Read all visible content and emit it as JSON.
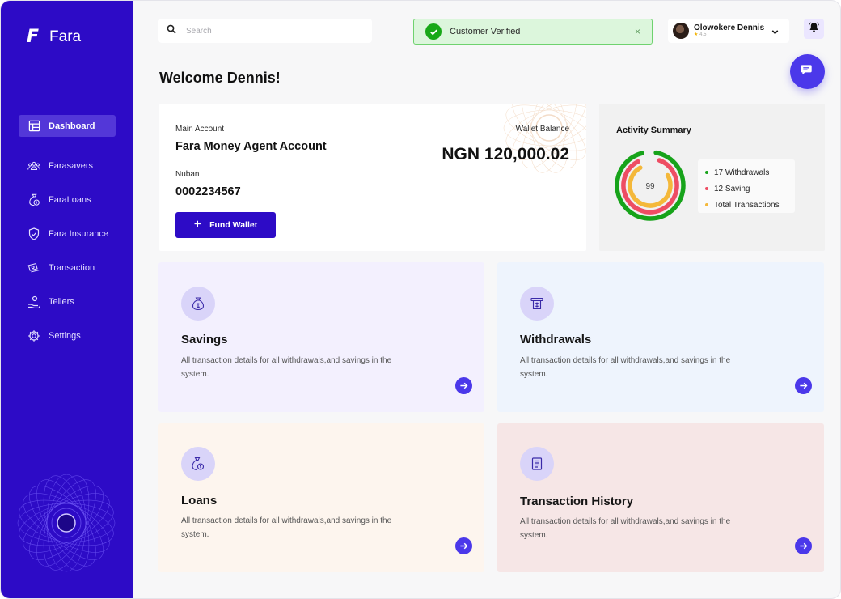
{
  "app": {
    "name": "Fara"
  },
  "colors": {
    "brand": "#2d0bc6",
    "accent": "#4b38ea",
    "success": "#18a818",
    "withdrawals": "#17a31a",
    "saving": "#ee4d63",
    "transactions": "#f4b83a"
  },
  "sidebar": {
    "items": [
      {
        "label": "Dashboard",
        "icon": "dashboard-icon",
        "active": true
      },
      {
        "label": "Farasavers",
        "icon": "users-group-icon",
        "active": false
      },
      {
        "label": "FaraLoans",
        "icon": "money-bag-icon",
        "active": false
      },
      {
        "label": "Fara Insurance",
        "icon": "shield-icon",
        "active": false
      },
      {
        "label": "Transaction",
        "icon": "cash-icon",
        "active": false
      },
      {
        "label": "Tellers",
        "icon": "teller-icon",
        "active": false
      },
      {
        "label": "Settings",
        "icon": "gear-icon",
        "active": false
      }
    ]
  },
  "header": {
    "search_placeholder": "Search",
    "toast": "Customer Verified",
    "toast_close": "×",
    "user": {
      "name": "Olowokere Dennis",
      "stars": "★",
      "rating": "4.5"
    }
  },
  "main": {
    "welcome": "Welcome Dennis!",
    "account": {
      "main_account_label": "Main Account",
      "main_account_name": "Fara Money Agent Account",
      "nuban_label": "Nuban",
      "nuban": "0002234567",
      "wallet_label": "Wallet Balance",
      "wallet_balance": "NGN 120,000.02",
      "fund_button": "Fund Wallet",
      "fund_button_icon": "plus-icon"
    },
    "activity": {
      "title": "Activity Summary",
      "center_value": "99",
      "legend": [
        {
          "label": "17 Withdrawals",
          "color": "#17a31a"
        },
        {
          "label": "12 Saving",
          "color": "#ee4d63"
        },
        {
          "label": "Total Transactions",
          "color": "#f4b83a"
        }
      ]
    },
    "tiles": [
      {
        "title": "Savings",
        "desc": "All transaction details for all withdrawals,and savings in the system.",
        "icon": "money-bag-icon",
        "bg": "#f3f0fe"
      },
      {
        "title": "Withdrawals",
        "desc": "All transaction details for all withdrawals,and savings  in the system.",
        "icon": "atm-withdrawal-icon",
        "bg": "#eef4fd"
      },
      {
        "title": "Loans",
        "desc": "All transaction details for all withdrawals,and savings in the system.",
        "icon": "loan-bag-icon",
        "bg": "#fdf5ee"
      },
      {
        "title": "Transaction History",
        "desc": "All transaction details for all withdrawals,and savings  in the system.",
        "icon": "document-icon",
        "bg": "#f6e6e6"
      }
    ]
  }
}
